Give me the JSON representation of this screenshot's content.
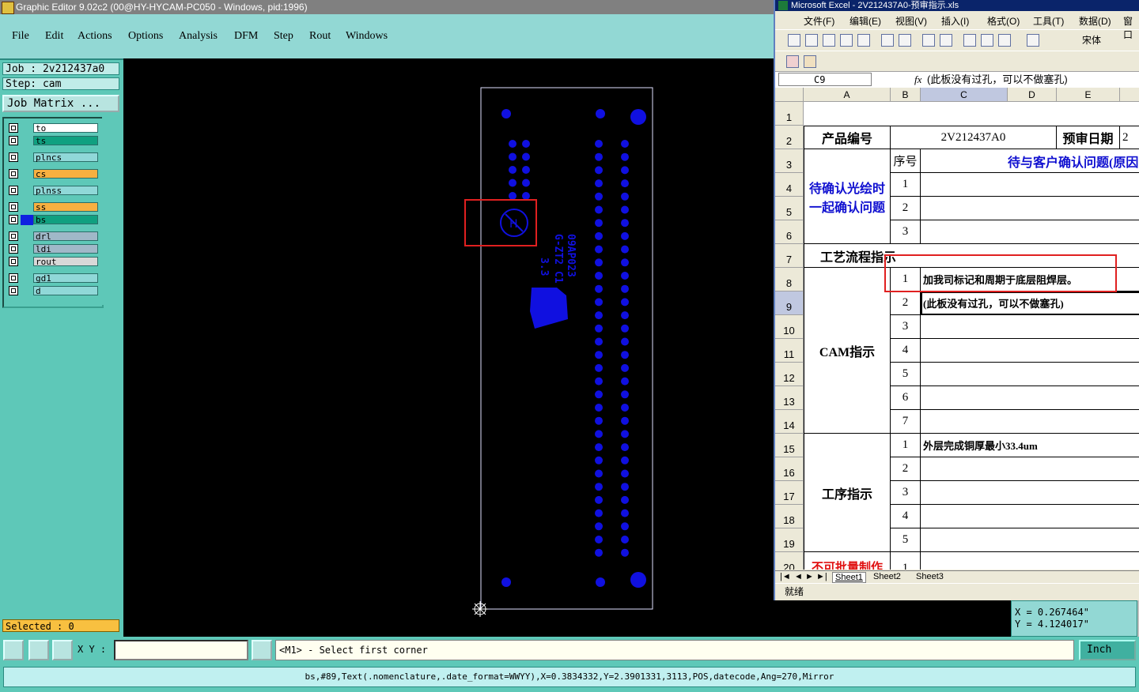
{
  "editor": {
    "title": "Graphic Editor 9.02c2 (00@HY-HYCAM-PC050 - Windows, pid:1996)",
    "menu": [
      "File",
      "Edit",
      "Actions",
      "Options",
      "Analysis",
      "DFM",
      "Step",
      "Rout",
      "Windows"
    ],
    "job": "Job : 2v212437a0",
    "step": "Step: cam",
    "job_matrix": "Job Matrix ...",
    "layers": [
      {
        "name": "to",
        "color": "#ffffff"
      },
      {
        "name": "ts",
        "color": "#10a080"
      },
      {
        "name": "plncs",
        "color": "#90d8d8"
      },
      {
        "name": "cs",
        "color": "#f8b040"
      },
      {
        "name": "plnss",
        "color": "#90d8d8"
      },
      {
        "name": "ss",
        "color": "#f8b040"
      },
      {
        "name": "bs",
        "color": "#10a080"
      },
      {
        "name": "drl",
        "color": "#a0b8c8"
      },
      {
        "name": "ldi",
        "color": "#a0b8c8"
      },
      {
        "name": "rout",
        "color": "#d8d8d8"
      },
      {
        "name": "gd1",
        "color": "#90d8d8"
      },
      {
        "name": "d",
        "color": "#90d8d8"
      }
    ],
    "selected": "Selected : 0",
    "xy_label": "X Y :",
    "xy_value": "",
    "prompt": "<M1> - Select first corner",
    "units": "Inch",
    "coords": {
      "x": "X  =  0.267464\"",
      "y": "Y  =  4.124017\""
    },
    "status": "bs,#89,Text(.nomenclature,.date_format=WWYY),X=0.3834332,Y=2.3901331,3113,POS,datecode,Ang=270,Mirror",
    "board_text": [
      "09AP023",
      "G-ZT2 C1",
      "3.3"
    ],
    "highlight_color": "#e02020",
    "pad_color": "#1010e0"
  },
  "excel": {
    "title": "Microsoft Excel - 2V212437A0-预审指示.xls",
    "menu": [
      "文件(F)",
      "编辑(E)",
      "视图(V)",
      "插入(I)",
      "格式(O)",
      "工具(T)",
      "数据(D)",
      "窗口"
    ],
    "font_box": "宋体",
    "name_box": "C9",
    "fx": "fx",
    "formula": "(此板没有过孔，可以不做塞孔)",
    "columns": [
      "A",
      "B",
      "C",
      "D",
      "E"
    ],
    "rows": [
      "1",
      "2",
      "3",
      "4",
      "5",
      "6",
      "7",
      "8",
      "9",
      "10",
      "11",
      "12",
      "13",
      "14",
      "15",
      "16",
      "17",
      "18",
      "19",
      "20"
    ],
    "cells": {
      "product_no_label": "产品编号",
      "product_no": "2V212437A0",
      "review_date_label": "预审日期",
      "review_date_partial": "2",
      "seq_label": "序号",
      "pending_header": "待与客户确认问题(原因",
      "pending_label": "待确认光绘时一起确认问题",
      "process_label": "工艺流程指示",
      "cam_label": "CAM指示",
      "op_label": "工序指示",
      "no_batch_label": "不可批量制作",
      "cam_item_1": "加我司标记和周期于底层阻焊层。",
      "cam_item_2": "(此板没有过孔，可以不做塞孔)",
      "op_item_1": "外层完成铜厚最小33.4um",
      "n1": "1",
      "n2": "2",
      "n3": "3",
      "n4": "4",
      "n5": "5",
      "n6": "6",
      "n7": "7"
    },
    "tabs": [
      "Sheet1",
      "Sheet2",
      "Sheet3"
    ],
    "status": "就绪"
  }
}
